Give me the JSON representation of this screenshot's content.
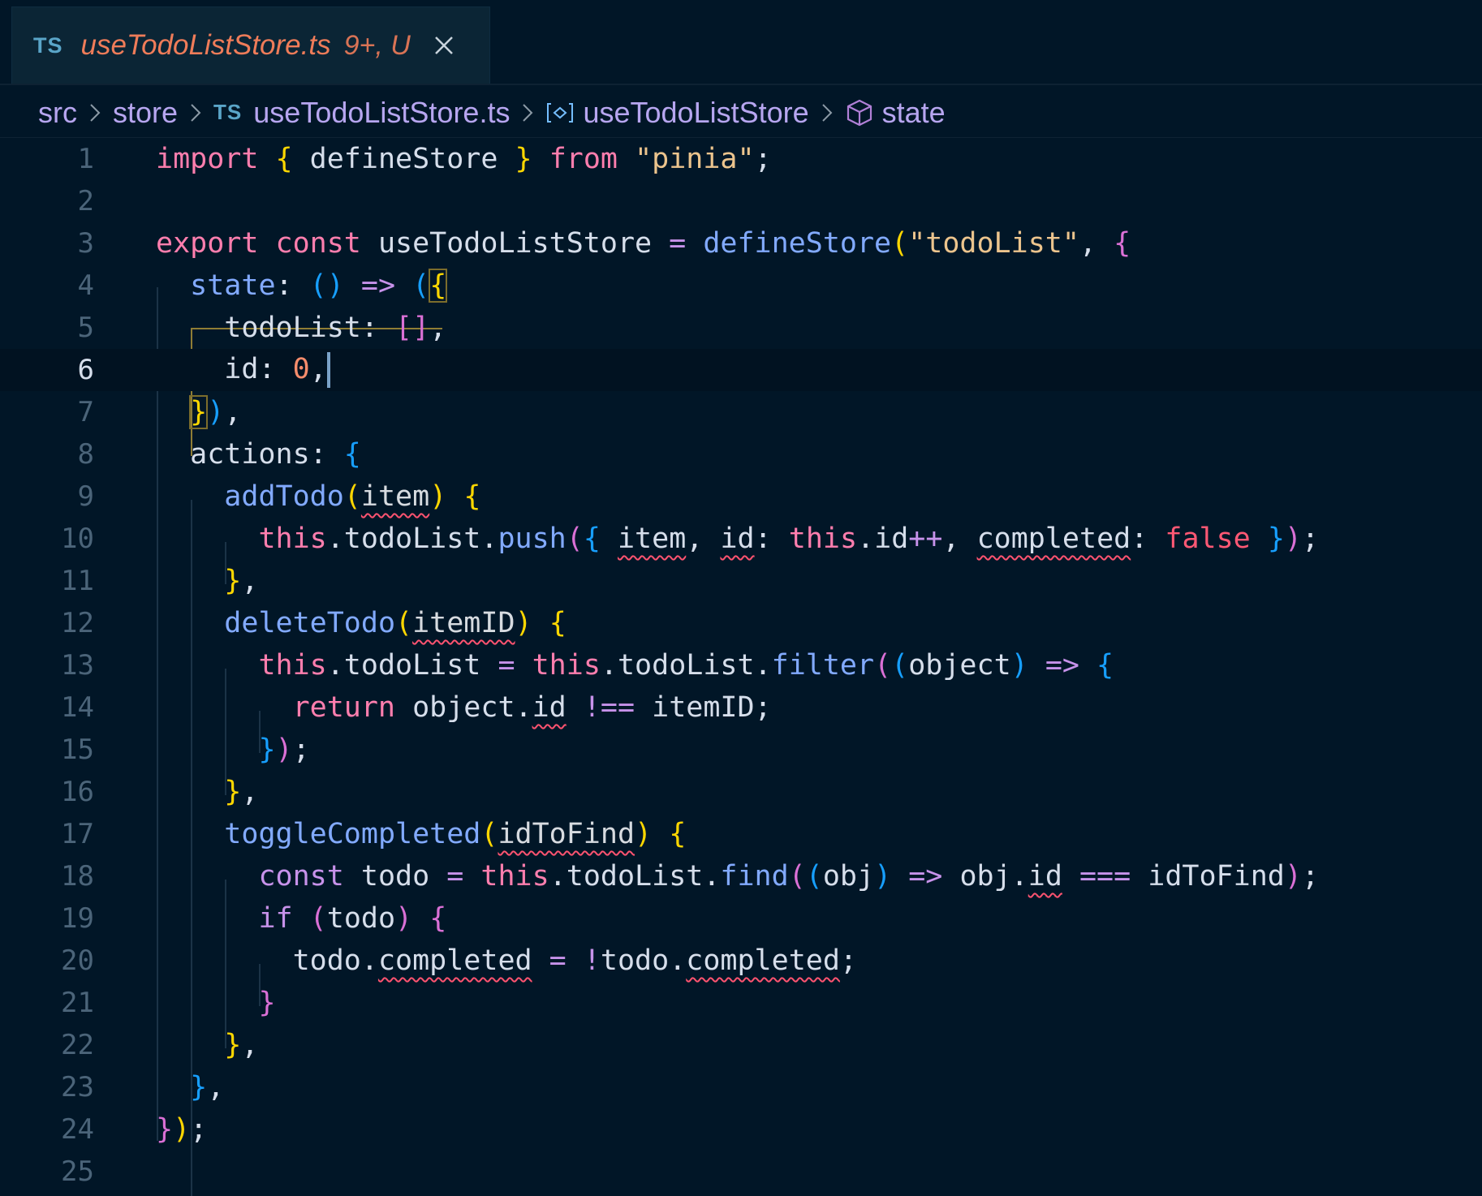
{
  "tab": {
    "lang_badge": "TS",
    "filename": "useTodoListStore.ts",
    "status": "9+, U",
    "close_icon": "close-icon"
  },
  "breadcrumb": {
    "items": [
      "src",
      "store",
      "useTodoListStore.ts",
      "useTodoListStore",
      "state"
    ],
    "file_badge": "TS",
    "icons": [
      "chevron-right-icon",
      "variable-icon",
      "cube-icon"
    ]
  },
  "editor": {
    "active_line": 6,
    "line_numbers": [
      "1",
      "2",
      "3",
      "4",
      "5",
      "6",
      "7",
      "8",
      "9",
      "10",
      "11",
      "12",
      "13",
      "14",
      "15",
      "16",
      "17",
      "18",
      "19",
      "20",
      "21",
      "22",
      "23",
      "24",
      "25"
    ],
    "lines": [
      "import { defineStore } from \"pinia\";",
      "",
      "export const useTodoListStore = defineStore(\"todoList\", {",
      "  state: () => ({",
      "    todoList: [],",
      "    id: 0,",
      "  }),",
      "  actions: {",
      "    addTodo(item) {",
      "      this.todoList.push({ item, id: this.id++, completed: false });",
      "    },",
      "    deleteTodo(itemID) {",
      "      this.todoList = this.todoList.filter((object) => {",
      "        return object.id !== itemID;",
      "      });",
      "    },",
      "    toggleCompleted(idToFind) {",
      "      const todo = this.todoList.find((obj) => obj.id === idToFind);",
      "      if (todo) {",
      "        todo.completed = !todo.completed;",
      "      }",
      "    },",
      "  },",
      "});",
      ""
    ]
  },
  "colors": {
    "background": "#011627",
    "tab_file": "#ef7c59",
    "breadcrumb": "#b7a6f0",
    "keyword": "#ff7eae",
    "string": "#ecc48d",
    "function": "#82aaff",
    "number": "#f78c6c",
    "boolean": "#ff5874",
    "error_squiggle": "#ff5370"
  }
}
